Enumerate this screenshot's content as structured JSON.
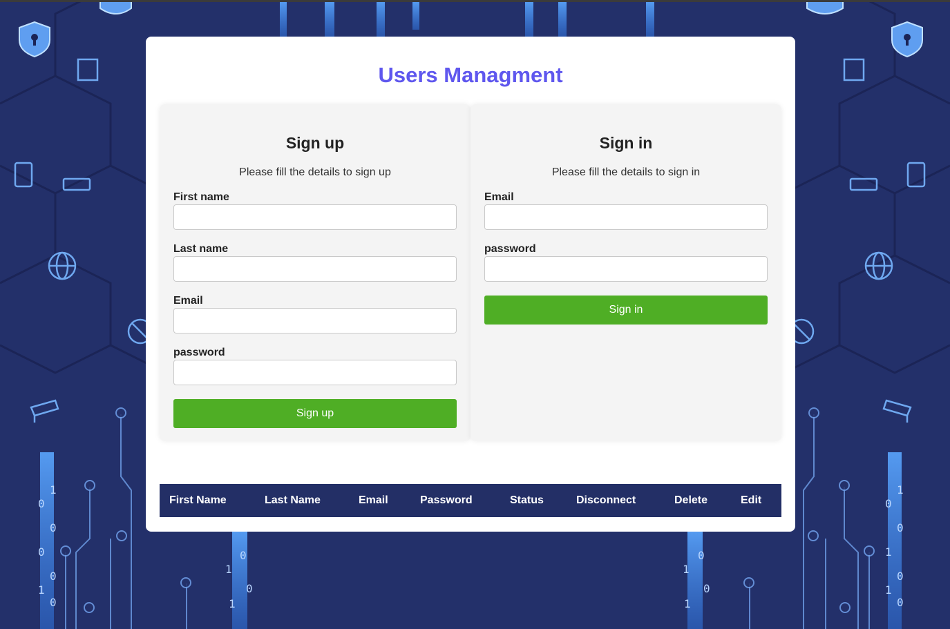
{
  "page": {
    "title": "Users Managment"
  },
  "signup": {
    "heading": "Sign up",
    "subtitle": "Please fill the details to sign up",
    "fields": [
      {
        "label": "First name",
        "value": ""
      },
      {
        "label": "Last name",
        "value": ""
      },
      {
        "label": "Email",
        "value": ""
      },
      {
        "label": "password",
        "value": ""
      }
    ],
    "button_label": "Sign up"
  },
  "signin": {
    "heading": "Sign in",
    "subtitle": "Please fill the details to sign in",
    "fields": [
      {
        "label": "Email",
        "value": ""
      },
      {
        "label": "password",
        "value": ""
      }
    ],
    "button_label": "Sign in"
  },
  "table": {
    "headers": [
      "First Name",
      "Last Name",
      "Email",
      "Password",
      "Status",
      "Disconnect",
      "Delete",
      "Edit"
    ],
    "rows": []
  },
  "colors": {
    "title": "#5f57ee",
    "button": "#4fae25",
    "table_header_bg": "#232f66",
    "background": "#23306a"
  }
}
